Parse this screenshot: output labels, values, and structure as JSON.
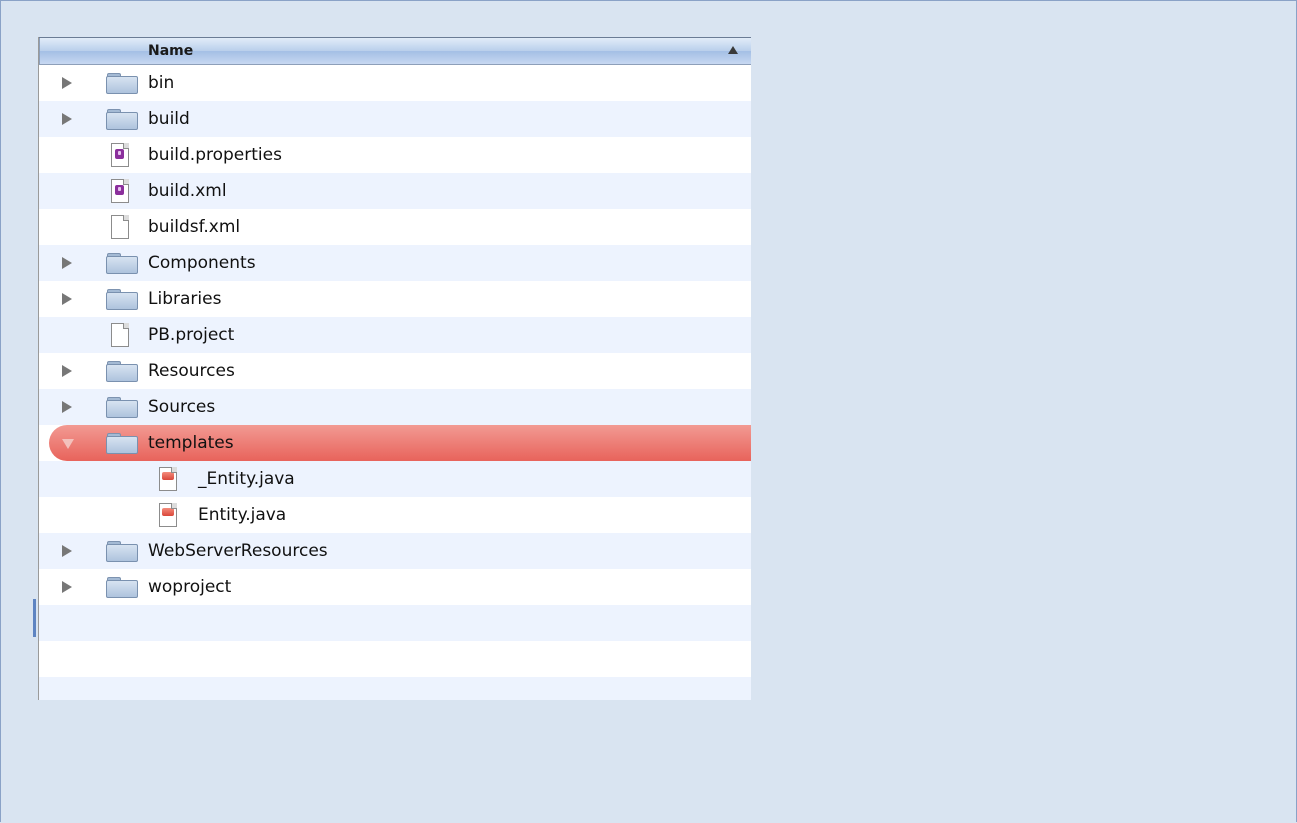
{
  "column_header": {
    "name": "Name",
    "sort": "ascending"
  },
  "rows": [
    {
      "label": "bin",
      "type": "folder",
      "expanded": false,
      "depth": 0
    },
    {
      "label": "build",
      "type": "folder",
      "expanded": false,
      "depth": 0
    },
    {
      "label": "build.properties",
      "type": "purple-doc",
      "depth": 0
    },
    {
      "label": "build.xml",
      "type": "purple-doc",
      "depth": 0
    },
    {
      "label": "buildsf.xml",
      "type": "blank-doc",
      "depth": 0
    },
    {
      "label": "Components",
      "type": "folder",
      "expanded": false,
      "depth": 0
    },
    {
      "label": "Libraries",
      "type": "folder",
      "expanded": false,
      "depth": 0
    },
    {
      "label": "PB.project",
      "type": "blank-doc",
      "depth": 0
    },
    {
      "label": "Resources",
      "type": "folder",
      "expanded": false,
      "depth": 0
    },
    {
      "label": "Sources",
      "type": "folder",
      "expanded": false,
      "depth": 0
    },
    {
      "label": "templates",
      "type": "folder",
      "expanded": true,
      "selected": true,
      "depth": 0
    },
    {
      "label": "_Entity.java",
      "type": "java-doc",
      "depth": 1
    },
    {
      "label": "Entity.java",
      "type": "java-doc",
      "depth": 1
    },
    {
      "label": "WebServerResources",
      "type": "folder",
      "expanded": false,
      "depth": 0
    },
    {
      "label": "woproject",
      "type": "folder",
      "expanded": false,
      "depth": 0
    }
  ],
  "colors": {
    "background": "#d9e4f1",
    "row_alt": "#edf3fe",
    "selection": "#e8635b"
  }
}
